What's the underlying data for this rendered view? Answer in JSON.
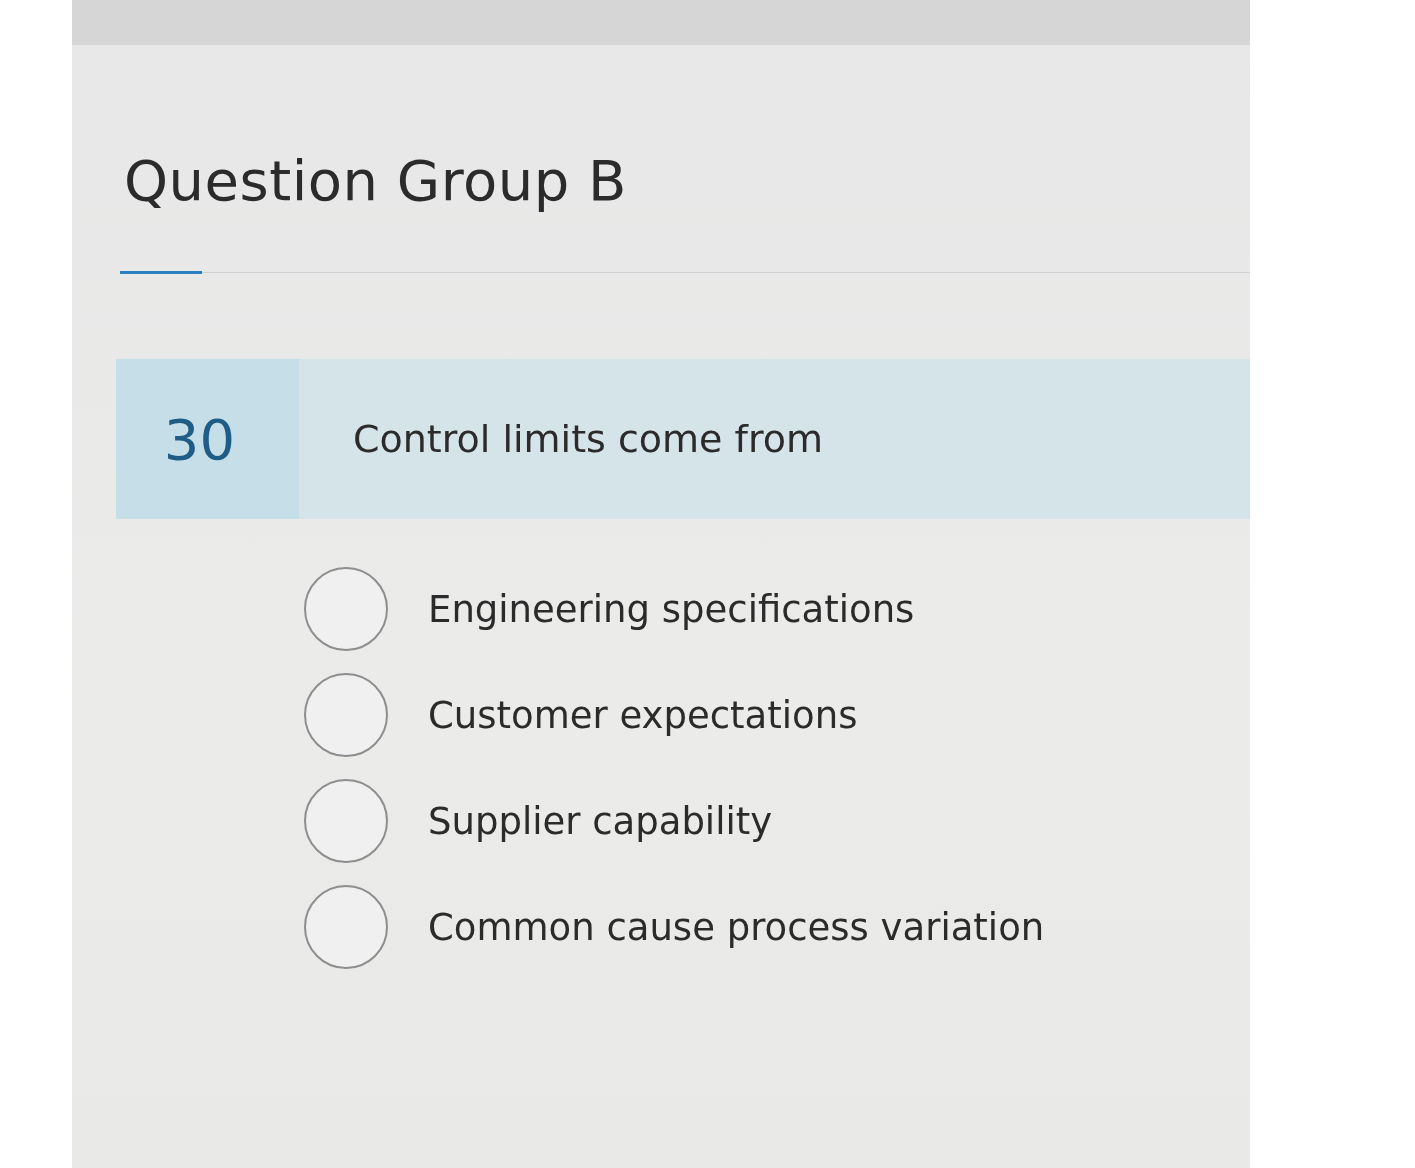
{
  "heading": "Question Group B",
  "question": {
    "number": "30",
    "text": "Control limits come from"
  },
  "options": [
    {
      "label": "Engineering specifications",
      "selected": false
    },
    {
      "label": "Customer expectations",
      "selected": false
    },
    {
      "label": "Supplier capability",
      "selected": false
    },
    {
      "label": "Common cause process variation",
      "selected": false
    }
  ]
}
